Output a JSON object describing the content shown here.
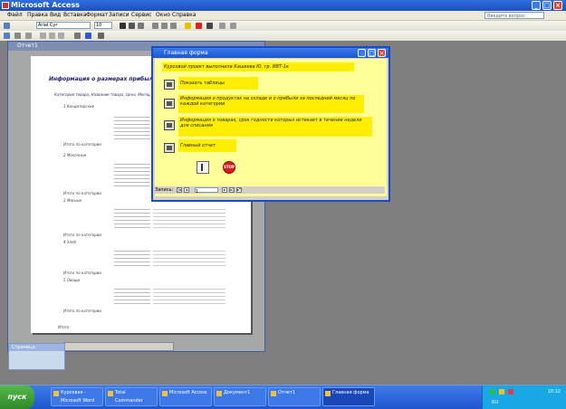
{
  "window": {
    "title": "Microsoft Access"
  },
  "menubar": {
    "items": [
      "Файл",
      "Правка",
      "Вид",
      "Вставка",
      "Формат",
      "Записи",
      "Сервис",
      "Окно",
      "Справка"
    ],
    "help_placeholder": "Введите вопрос"
  },
  "toolbar": {
    "font_name": "Arial Cyr",
    "font_size": "10"
  },
  "report_window": {
    "title": "Отчет1"
  },
  "report": {
    "title": "Информация о размерах прибыли",
    "subtitle": "Категория товара, Название товара, Цена, Месяц, Сумма",
    "groups": [
      {
        "header": "1 Кондитерские",
        "footer": "Итого по категории"
      },
      {
        "header": "2 Молочные",
        "footer": "Итого по категории"
      },
      {
        "header": "3 Мясные",
        "footer": "Итого по категории"
      },
      {
        "header": "4 Хлеб",
        "footer": "Итого по категории"
      },
      {
        "header": "5 Овощи",
        "footer": "Итого по категории"
      }
    ],
    "grand_total": "Итого"
  },
  "page_panel": {
    "header": "Страница"
  },
  "dialog": {
    "title": "Главная форма",
    "header": "Курсовой проект выполнила Кашеева Ю. гр. ИВТ-1к",
    "items": [
      {
        "label": "Показать таблицы"
      },
      {
        "label": "Информация о продуктах на складе и о прибыли за последний месяц по каждой категории"
      },
      {
        "label": "Информация о товарах, срок годности которых истекает в течение недели для списания"
      },
      {
        "label": "Главный отчет"
      }
    ],
    "stop_label": "STOP",
    "record_label": "Запись:",
    "record_value": "1"
  },
  "taskbar": {
    "start_label": "пуск",
    "tasks": [
      "Курсовая - Microsoft Word",
      "Total Commander",
      "Microsoft Access",
      "Документ1",
      "Отчет1",
      "Главная форма"
    ],
    "active_task": "Главная форма",
    "tray_lang": "RU",
    "clock": "10:12"
  },
  "colors": {
    "title_blue": "#1c4fc0",
    "dialog_body": "#ffff99",
    "dialog_label_bg": "#ffee00",
    "stop_red": "#d21e1e",
    "start_green": "#2f8a2a"
  },
  "icons": [
    "app-icon",
    "minimize-icon",
    "maximize-icon",
    "close-icon",
    "stop-icon",
    "door-icon",
    "table-icon",
    "report-icon",
    "form-icon"
  ]
}
